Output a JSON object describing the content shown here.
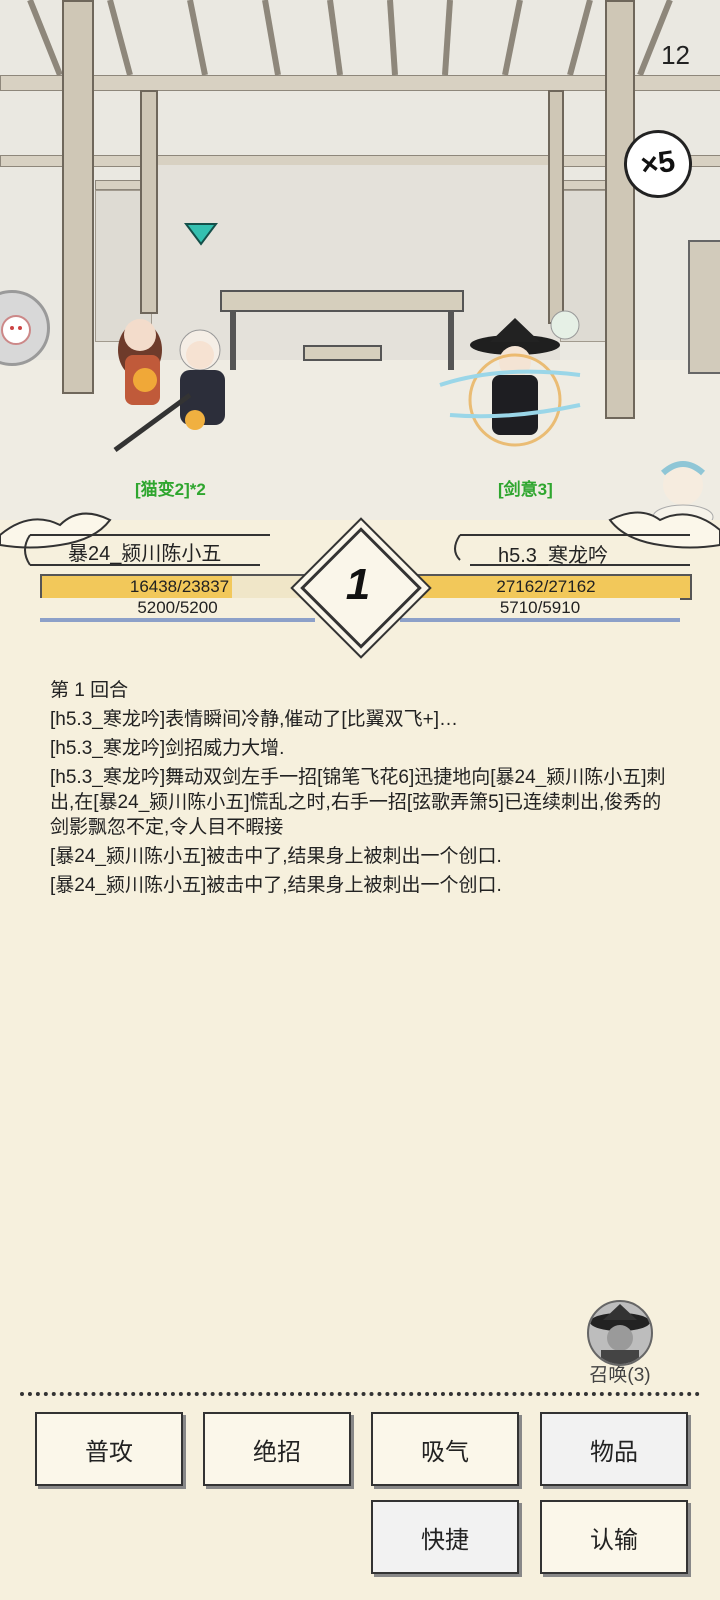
{
  "battle": {
    "turn_counter": "12",
    "speed": "×5",
    "left_status": "[猫变2]*2",
    "right_status": "[剑意3]"
  },
  "player": {
    "name": "暴24_颍川陈小五",
    "hp_text": "16438/23837",
    "hp_fraction": 0.69,
    "mp_text": "5200/5200",
    "mp_fraction": 1.0
  },
  "enemy": {
    "name": "h5.3_寒龙吟",
    "hp_text": "27162/27162",
    "hp_fraction": 1.0,
    "mp_text": "5710/5910",
    "mp_fraction": 0.97
  },
  "round_number": "1",
  "log": [
    "第 1 回合",
    "[h5.3_寒龙吟]表情瞬间冷静,催动了[比翼双飞+]…",
    "[h5.3_寒龙吟]剑招威力大增.",
    "[h5.3_寒龙吟]舞动双剑左手一招[锦笔飞花6]迅捷地向[暴24_颍川陈小五]刺出,在[暴24_颍川陈小五]慌乱之时,右手一招[弦歌弄箫5]已连续刺出,俊秀的剑影飘忽不定,令人目不暇接",
    "[暴24_颍川陈小五]被击中了,结果身上被刺出一个创口.",
    "[暴24_颍川陈小五]被击中了,结果身上被刺出一个创口."
  ],
  "summon_label": "召唤(3)",
  "actions": {
    "normal_attack": "普攻",
    "ultimate": "绝招",
    "breath": "吸气",
    "items": "物品",
    "quick": "快捷",
    "surrender": "认输"
  },
  "colors": {
    "hp_bar": "#f2c85a",
    "mp_bar": "#8ca0c8",
    "status_green": "#2fa62f",
    "background": "#f6f0dd"
  }
}
